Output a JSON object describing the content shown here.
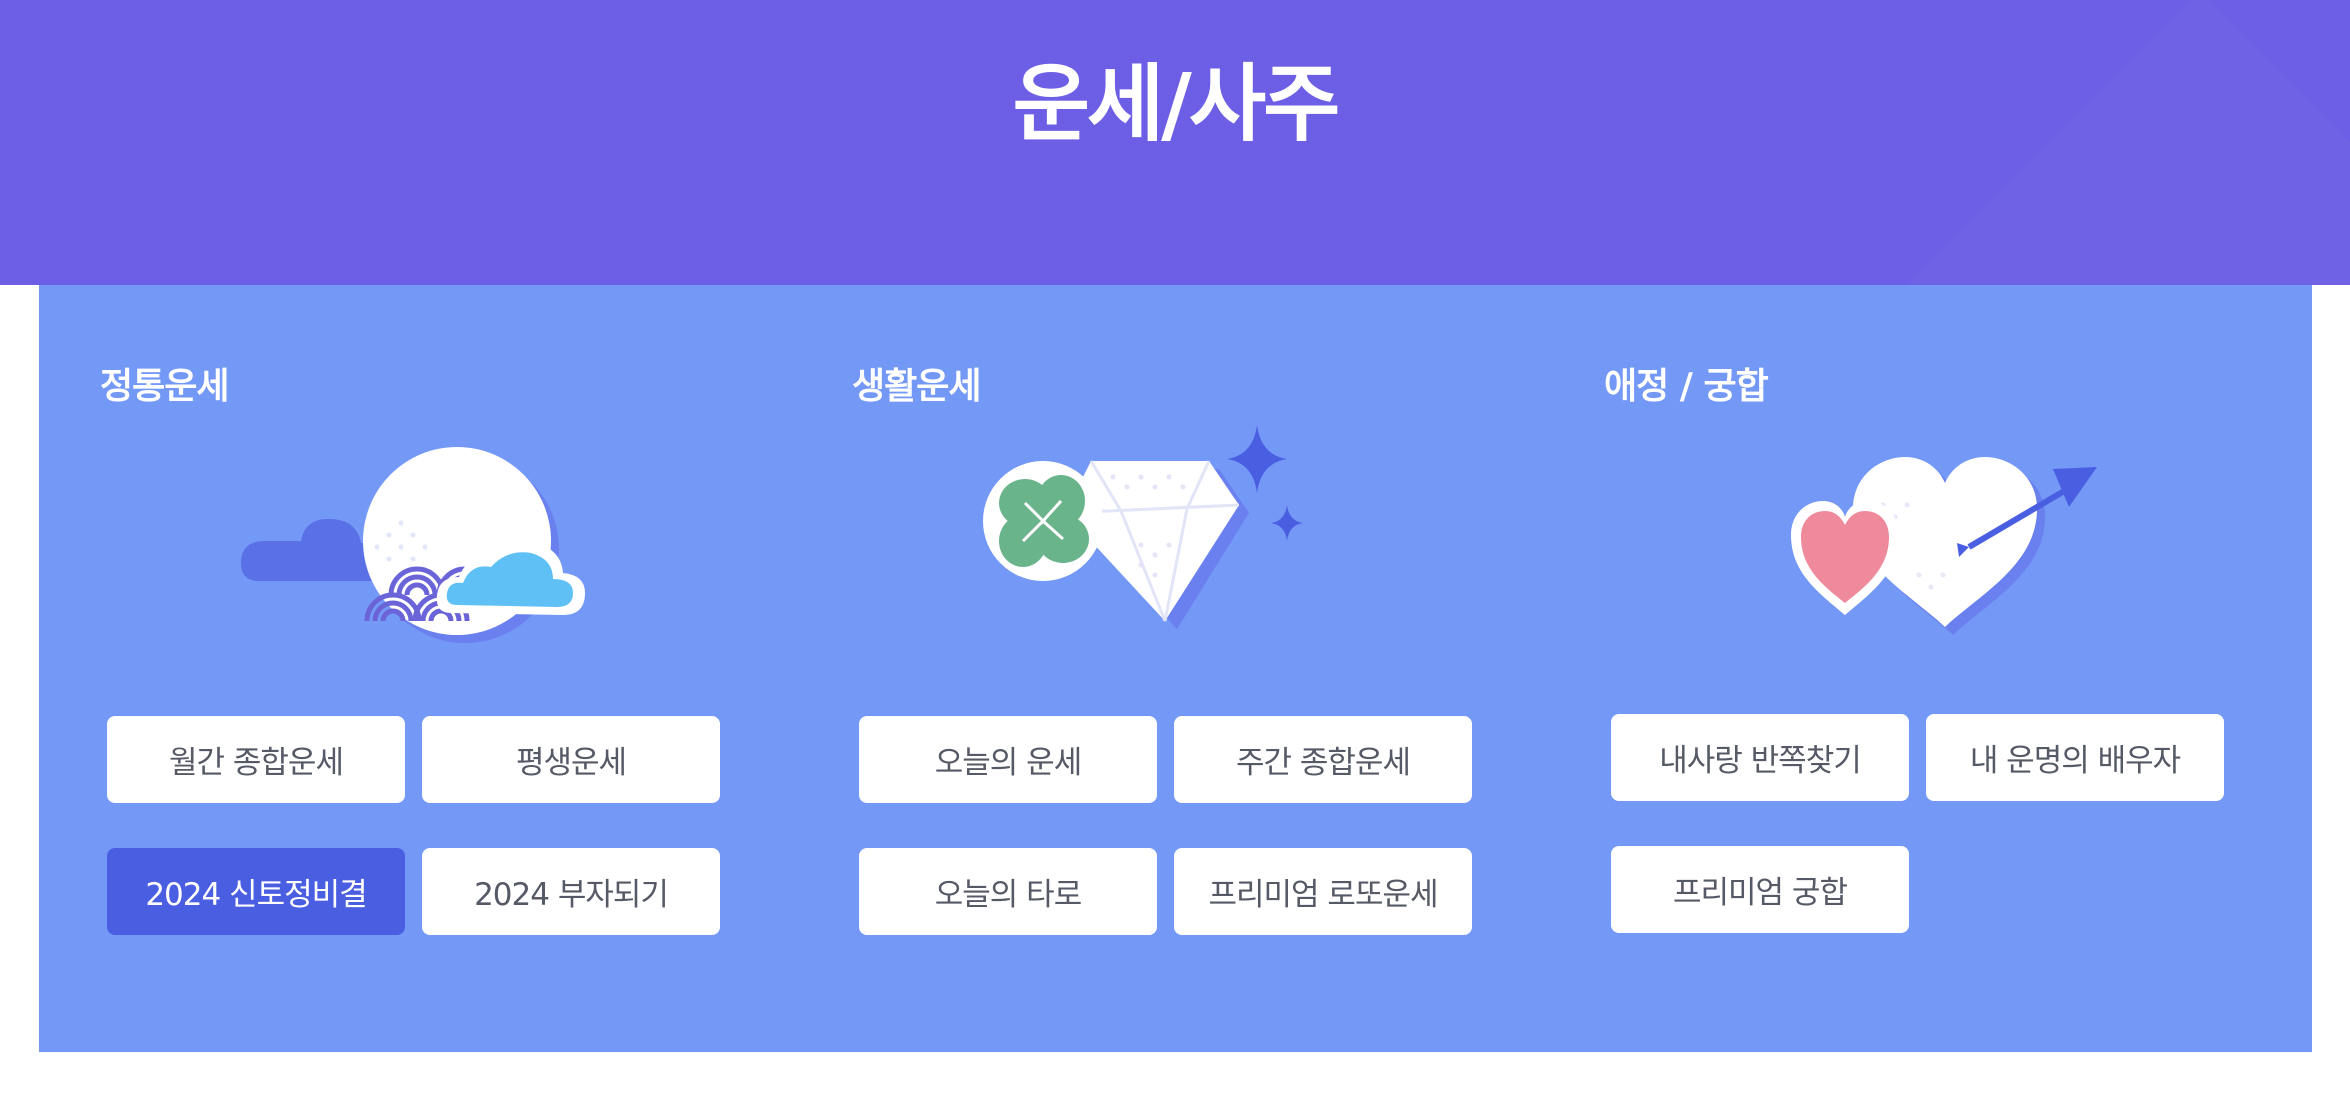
{
  "page": {
    "title": "운세/사주"
  },
  "colors": {
    "header_bg": "#6c5fe5",
    "panel_bg": "#7498f6",
    "button_bg": "#ffffff",
    "button_active_bg": "#4a5ee2",
    "button_text": "#555a66"
  },
  "sections": [
    {
      "title": "정통운세",
      "icon": "moon-cloud-icon",
      "buttons": [
        {
          "label": "월간 종합운세",
          "active": false
        },
        {
          "label": "평생운세",
          "active": false
        },
        {
          "label": "2024 신토정비결",
          "active": true
        },
        {
          "label": "2024 부자되기",
          "active": false
        }
      ]
    },
    {
      "title": "생활운세",
      "icon": "clover-diamond-icon",
      "buttons": [
        {
          "label": "오늘의 운세",
          "active": false
        },
        {
          "label": "주간 종합운세",
          "active": false
        },
        {
          "label": "오늘의 타로",
          "active": false
        },
        {
          "label": "프리미엄 로또운세",
          "active": false
        }
      ]
    },
    {
      "title": "애정 / 궁합",
      "icon": "hearts-arrow-icon",
      "buttons": [
        {
          "label": "내사랑 반쪽찾기",
          "active": false
        },
        {
          "label": "내 운명의 배우자",
          "active": false
        },
        {
          "label": "프리미엄 궁합",
          "active": false
        }
      ]
    }
  ]
}
